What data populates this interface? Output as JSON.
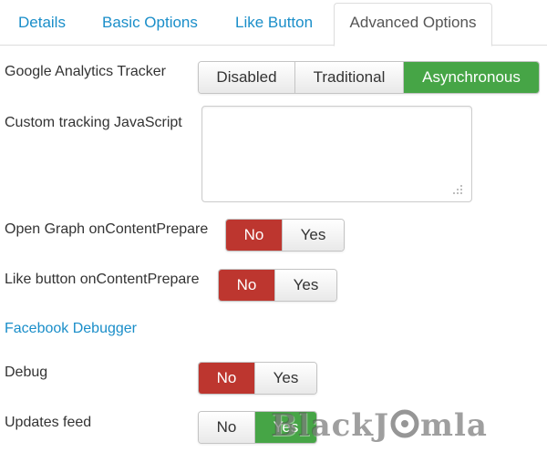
{
  "tabs": [
    {
      "label": "Details",
      "active": false
    },
    {
      "label": "Basic Options",
      "active": false
    },
    {
      "label": "Like Button",
      "active": false
    },
    {
      "label": "Advanced Options",
      "active": true
    }
  ],
  "fields": {
    "ga_tracker": {
      "label": "Google Analytics Tracker",
      "options": [
        "Disabled",
        "Traditional",
        "Asynchronous"
      ],
      "selected": "Asynchronous"
    },
    "custom_js": {
      "label": "Custom tracking JavaScript",
      "value": ""
    },
    "og_prepare": {
      "label": "Open Graph onContentPrepare",
      "options": [
        "No",
        "Yes"
      ],
      "selected": "No"
    },
    "like_prepare": {
      "label": "Like button onContentPrepare",
      "options": [
        "No",
        "Yes"
      ],
      "selected": "No"
    },
    "fb_debugger": {
      "label": "Facebook Debugger"
    },
    "debug": {
      "label": "Debug",
      "options": [
        "No",
        "Yes"
      ],
      "selected": "No"
    },
    "updates_feed": {
      "label": "Updates feed",
      "options": [
        "No",
        "Yes"
      ],
      "selected": "Yes"
    }
  },
  "colors": {
    "link": "#1a8ec9",
    "active_green": "#46a546",
    "active_red": "#bd362f"
  },
  "watermark": {
    "text_left": "BlackJ",
    "text_right": "mla"
  }
}
